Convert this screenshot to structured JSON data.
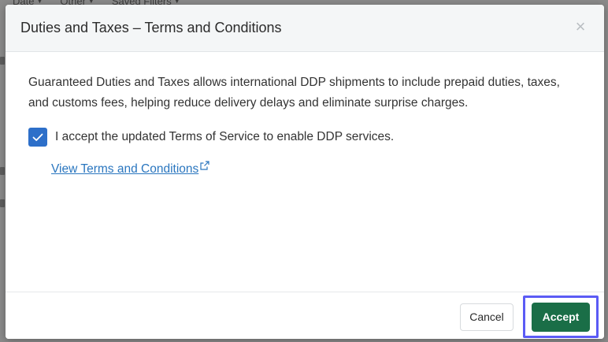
{
  "background": {
    "filters": [
      {
        "label": "Date"
      },
      {
        "label": "Other"
      },
      {
        "label": "Saved Filters"
      }
    ]
  },
  "modal": {
    "title": "Duties and Taxes – Terms and Conditions",
    "close_icon": "close-icon",
    "description": "Guaranteed Duties and Taxes allows international DDP shipments to include prepaid duties, taxes, and customs fees, helping reduce delivery delays and eliminate surprise charges.",
    "checkbox": {
      "checked": true,
      "label": "I accept the updated Terms of Service to enable DDP services."
    },
    "terms_link": {
      "label": "View Terms and Conditions",
      "icon": "external-link-icon"
    },
    "footer": {
      "cancel_label": "Cancel",
      "accept_label": "Accept"
    }
  },
  "colors": {
    "checkbox": "#2d6fc9",
    "link": "#2a76bf",
    "accept": "#1a6e47",
    "highlight": "#5b5bf5"
  }
}
